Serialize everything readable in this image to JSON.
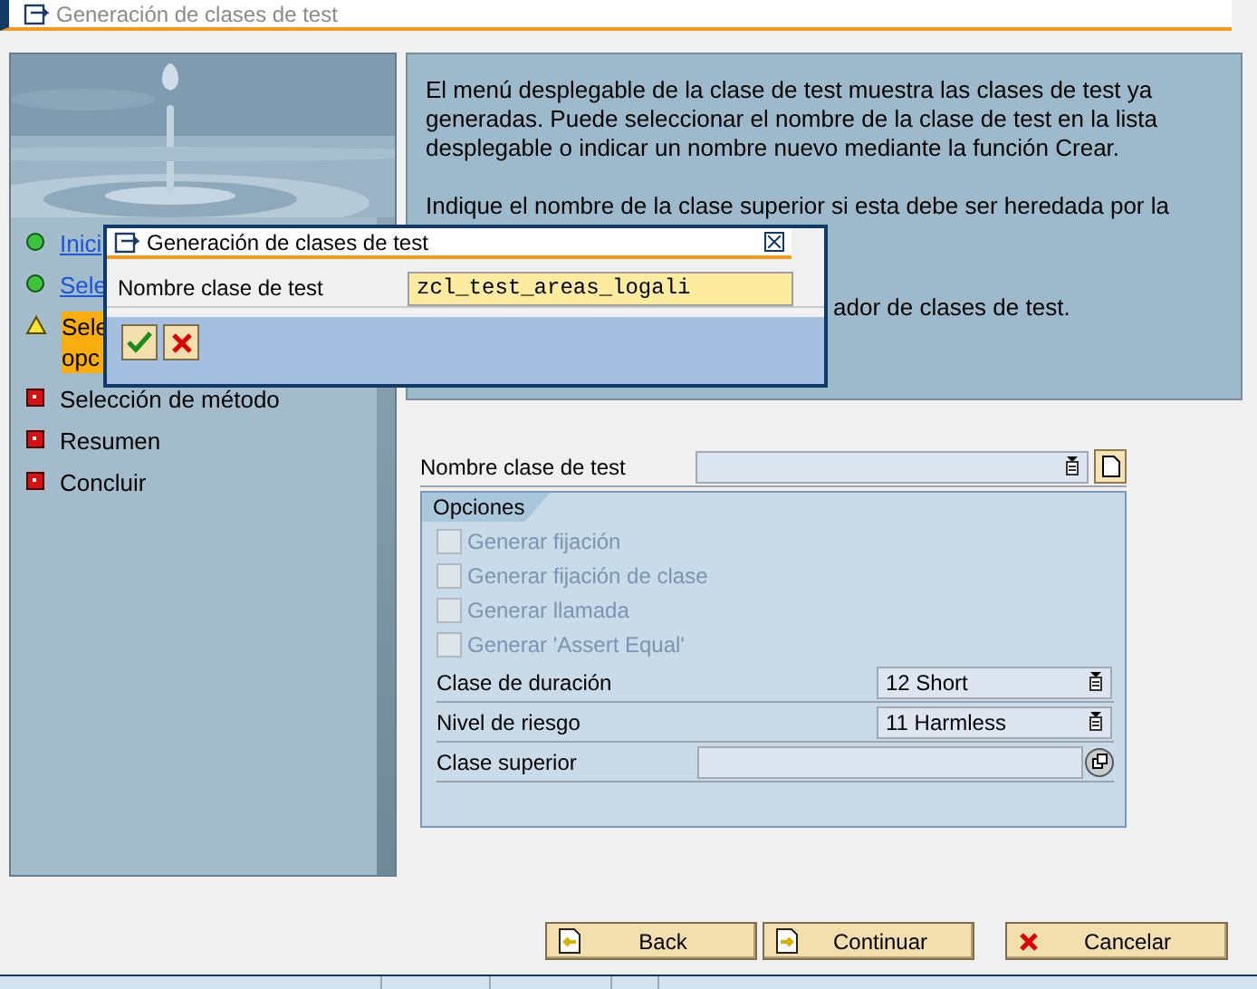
{
  "window": {
    "title": "Generación de clases de test"
  },
  "steps": [
    {
      "label": "Inici",
      "kind": "done",
      "link": true,
      "selected": false
    },
    {
      "label": "Sele",
      "kind": "done",
      "link": true,
      "selected": false
    },
    {
      "label": "Sele\nopc",
      "kind": "current",
      "link": false,
      "selected": true
    },
    {
      "label": "Selección de método",
      "kind": "pending",
      "link": false,
      "selected": false
    },
    {
      "label": "Resumen",
      "kind": "pending",
      "link": false,
      "selected": false
    },
    {
      "label": "Concluir",
      "kind": "pending",
      "link": false,
      "selected": false
    }
  ],
  "info": {
    "paragraphs": [
      "El menú desplegable de la clase de test muestra las clases de test ya generadas. Puede seleccionar el nombre de la clase de test en la lista desplegable o indicar un nombre nuevo mediante la función Crear.",
      "Indique el nombre de la clase superior si esta debe ser heredada por la"
    ],
    "fragment": "ador de clases de test."
  },
  "form": {
    "class_name": {
      "label": "Nombre clase de test"
    },
    "options": {
      "title": "Opciones",
      "checkboxes": [
        {
          "label": "Generar fijación",
          "checked": false,
          "disabled": true
        },
        {
          "label": "Generar fijación de clase",
          "checked": false,
          "disabled": true
        },
        {
          "label": "Generar llamada",
          "checked": false,
          "disabled": true
        },
        {
          "label": "Generar 'Assert Equal'",
          "checked": false,
          "disabled": true
        }
      ],
      "fields": [
        {
          "label": "Clase de duración",
          "kind": "dropdown",
          "value": "12 Short"
        },
        {
          "label": "Nivel de riesgo",
          "kind": "dropdown",
          "value": "11 Harmless"
        },
        {
          "label": "Clase superior",
          "kind": "search"
        }
      ]
    }
  },
  "buttons": [
    {
      "label": "Back",
      "kind": "back"
    },
    {
      "label": "Continuar",
      "kind": "next"
    },
    {
      "label": "Cancelar",
      "kind": "cancel"
    }
  ],
  "dialog": {
    "title": "Generación de clases de test",
    "field": {
      "label": "Nombre clase de test",
      "value": "zcl_test_areas_logali"
    }
  }
}
